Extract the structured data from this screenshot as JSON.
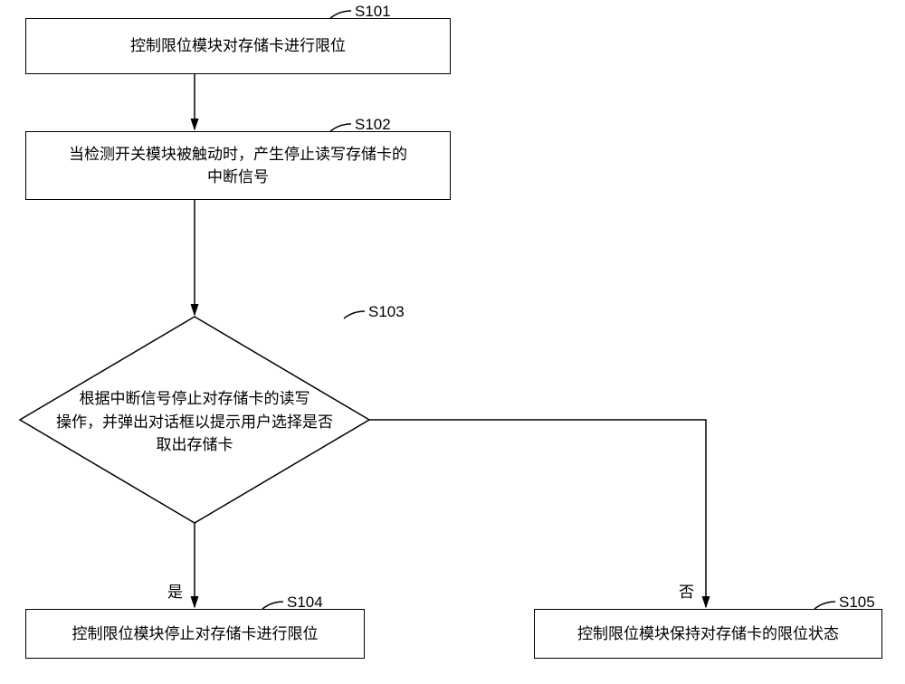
{
  "chart_data": {
    "type": "flowchart",
    "nodes": [
      {
        "id": "S101",
        "label": "S101",
        "text": "控制限位模块对存储卡进行限位",
        "shape": "rect"
      },
      {
        "id": "S102",
        "label": "S102",
        "text": "当检测开关模块被触动时，产生停止读写存储卡的中断信号",
        "shape": "rect"
      },
      {
        "id": "S103",
        "label": "S103",
        "text": "根据中断信号停止对存储卡的读写操作，并弹出对话框以提示用户选择是否取出存储卡",
        "shape": "diamond"
      },
      {
        "id": "S104",
        "label": "S104",
        "text": "控制限位模块停止对存储卡进行限位",
        "shape": "rect"
      },
      {
        "id": "S105",
        "label": "S105",
        "text": "控制限位模块保持对存储卡的限位状态",
        "shape": "rect"
      }
    ],
    "edges": [
      {
        "from": "S101",
        "to": "S102",
        "label": ""
      },
      {
        "from": "S102",
        "to": "S103",
        "label": ""
      },
      {
        "from": "S103",
        "to": "S104",
        "label": "是"
      },
      {
        "from": "S103",
        "to": "S105",
        "label": "否"
      }
    ]
  },
  "labels": {
    "s101": "S101",
    "s102": "S102",
    "s103": "S103",
    "s104": "S104",
    "s105": "S105"
  },
  "texts": {
    "s101": "控制限位模块对存储卡进行限位",
    "s102": "当检测开关模块被触动时，产生停止读写存储卡的\n中断信号",
    "s103_line1": "根据中断信号停止对存储卡的读写",
    "s103_line2": "操作，并弹出对话框以提示用户选择是否",
    "s103_line3": "取出存储卡",
    "s104": "控制限位模块停止对存储卡进行限位",
    "s105": "控制限位模块保持对存储卡的限位状态"
  },
  "edgeLabels": {
    "yes": "是",
    "no": "否"
  }
}
